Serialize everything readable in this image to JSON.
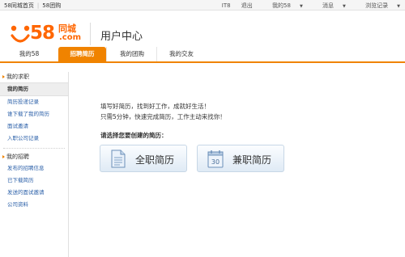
{
  "topbar": {
    "left_links": [
      "58同城首页",
      "58团购"
    ],
    "right_links": [
      "IT8",
      "退出",
      "我的58",
      "消息",
      "浏览记录"
    ]
  },
  "header": {
    "logo": {
      "number": "58",
      "city": "同城",
      "domain": ".com"
    },
    "title": "用户中心"
  },
  "nav": {
    "tabs": [
      {
        "label": "我的58",
        "active": false
      },
      {
        "label": "招聘简历",
        "active": true
      },
      {
        "label": "我的团购",
        "active": false
      },
      {
        "label": "我的交友",
        "active": false
      }
    ]
  },
  "sidebar": {
    "group1_title": "我的求职",
    "group1_items": [
      "我的简历",
      "简历投递记录",
      "谁下载了我的简历",
      "面试邀请",
      "入职公司记录"
    ],
    "group2_title": "我的招聘",
    "group2_items": [
      "发布的招聘信息",
      "已下载简历",
      "发送的面试邀请",
      "公司资料"
    ]
  },
  "main": {
    "intro_line1": "填写好简历，找到好工作，成就好生活！",
    "intro_line2": "只需5分钟，快速完成简历，工作主动来找你！",
    "choose_label": "请选择您要创建的简历：",
    "fulltime_label": "全职简历",
    "parttime_label": "兼职简历",
    "parttime_icon_number": "30"
  },
  "colors": {
    "accent": "#f08300",
    "logo": "#ff6600",
    "link": "#2a5fa8"
  }
}
